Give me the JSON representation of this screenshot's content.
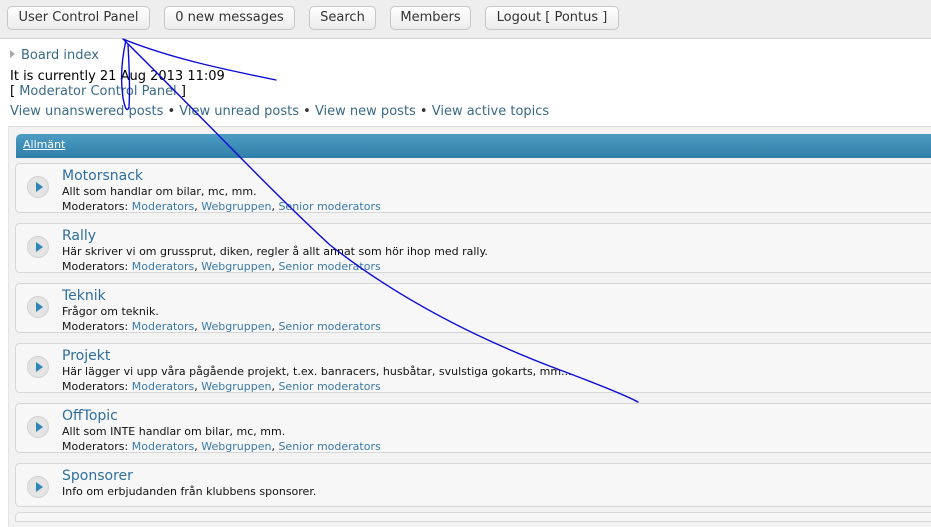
{
  "nav": {
    "ucp": "User Control Panel",
    "messages": "0 new messages",
    "search": "Search",
    "members": "Members",
    "logout": "Logout [ Pontus ]"
  },
  "header": {
    "board_index": "Board index",
    "current_time": "It is currently 21 Aug 2013 11:09",
    "mcp_open": "[ ",
    "mcp": "Moderator Control Panel",
    "mcp_close": " ]",
    "links": [
      "View unanswered posts",
      "View unread posts",
      "View new posts",
      "View active topics"
    ],
    "separator": " • "
  },
  "category": {
    "name": "Allmänt"
  },
  "forums": [
    {
      "title": "Motorsnack",
      "desc": "Allt som handlar om bilar, mc, mm.",
      "has_mods": true
    },
    {
      "title": "Rally",
      "desc": "Här skriver vi om grussprut, diken, regler å allt annat som hör ihop med rally.",
      "has_mods": true
    },
    {
      "title": "Teknik",
      "desc": "Frågor om teknik.",
      "has_mods": true
    },
    {
      "title": "Projekt",
      "desc": "Här lägger vi upp våra pågående projekt, t.ex. banracers, husbåtar, svulstiga gokarts, mm...",
      "has_mods": true
    },
    {
      "title": "OffTopic",
      "desc": "Allt som INTE handlar om bilar, mc, mm.",
      "has_mods": true
    },
    {
      "title": "Sponsorer",
      "desc": "Info om erbjudanden från klubbens sponsorer.",
      "has_mods": false
    }
  ],
  "mods": {
    "label": "Moderators: ",
    "list": [
      "Moderators",
      "Webgruppen",
      "Senior moderators"
    ],
    "comma": ", "
  },
  "colors": {
    "accent": "#2f7fa8",
    "link": "#3a6a86",
    "annotation": "#0000cc"
  }
}
